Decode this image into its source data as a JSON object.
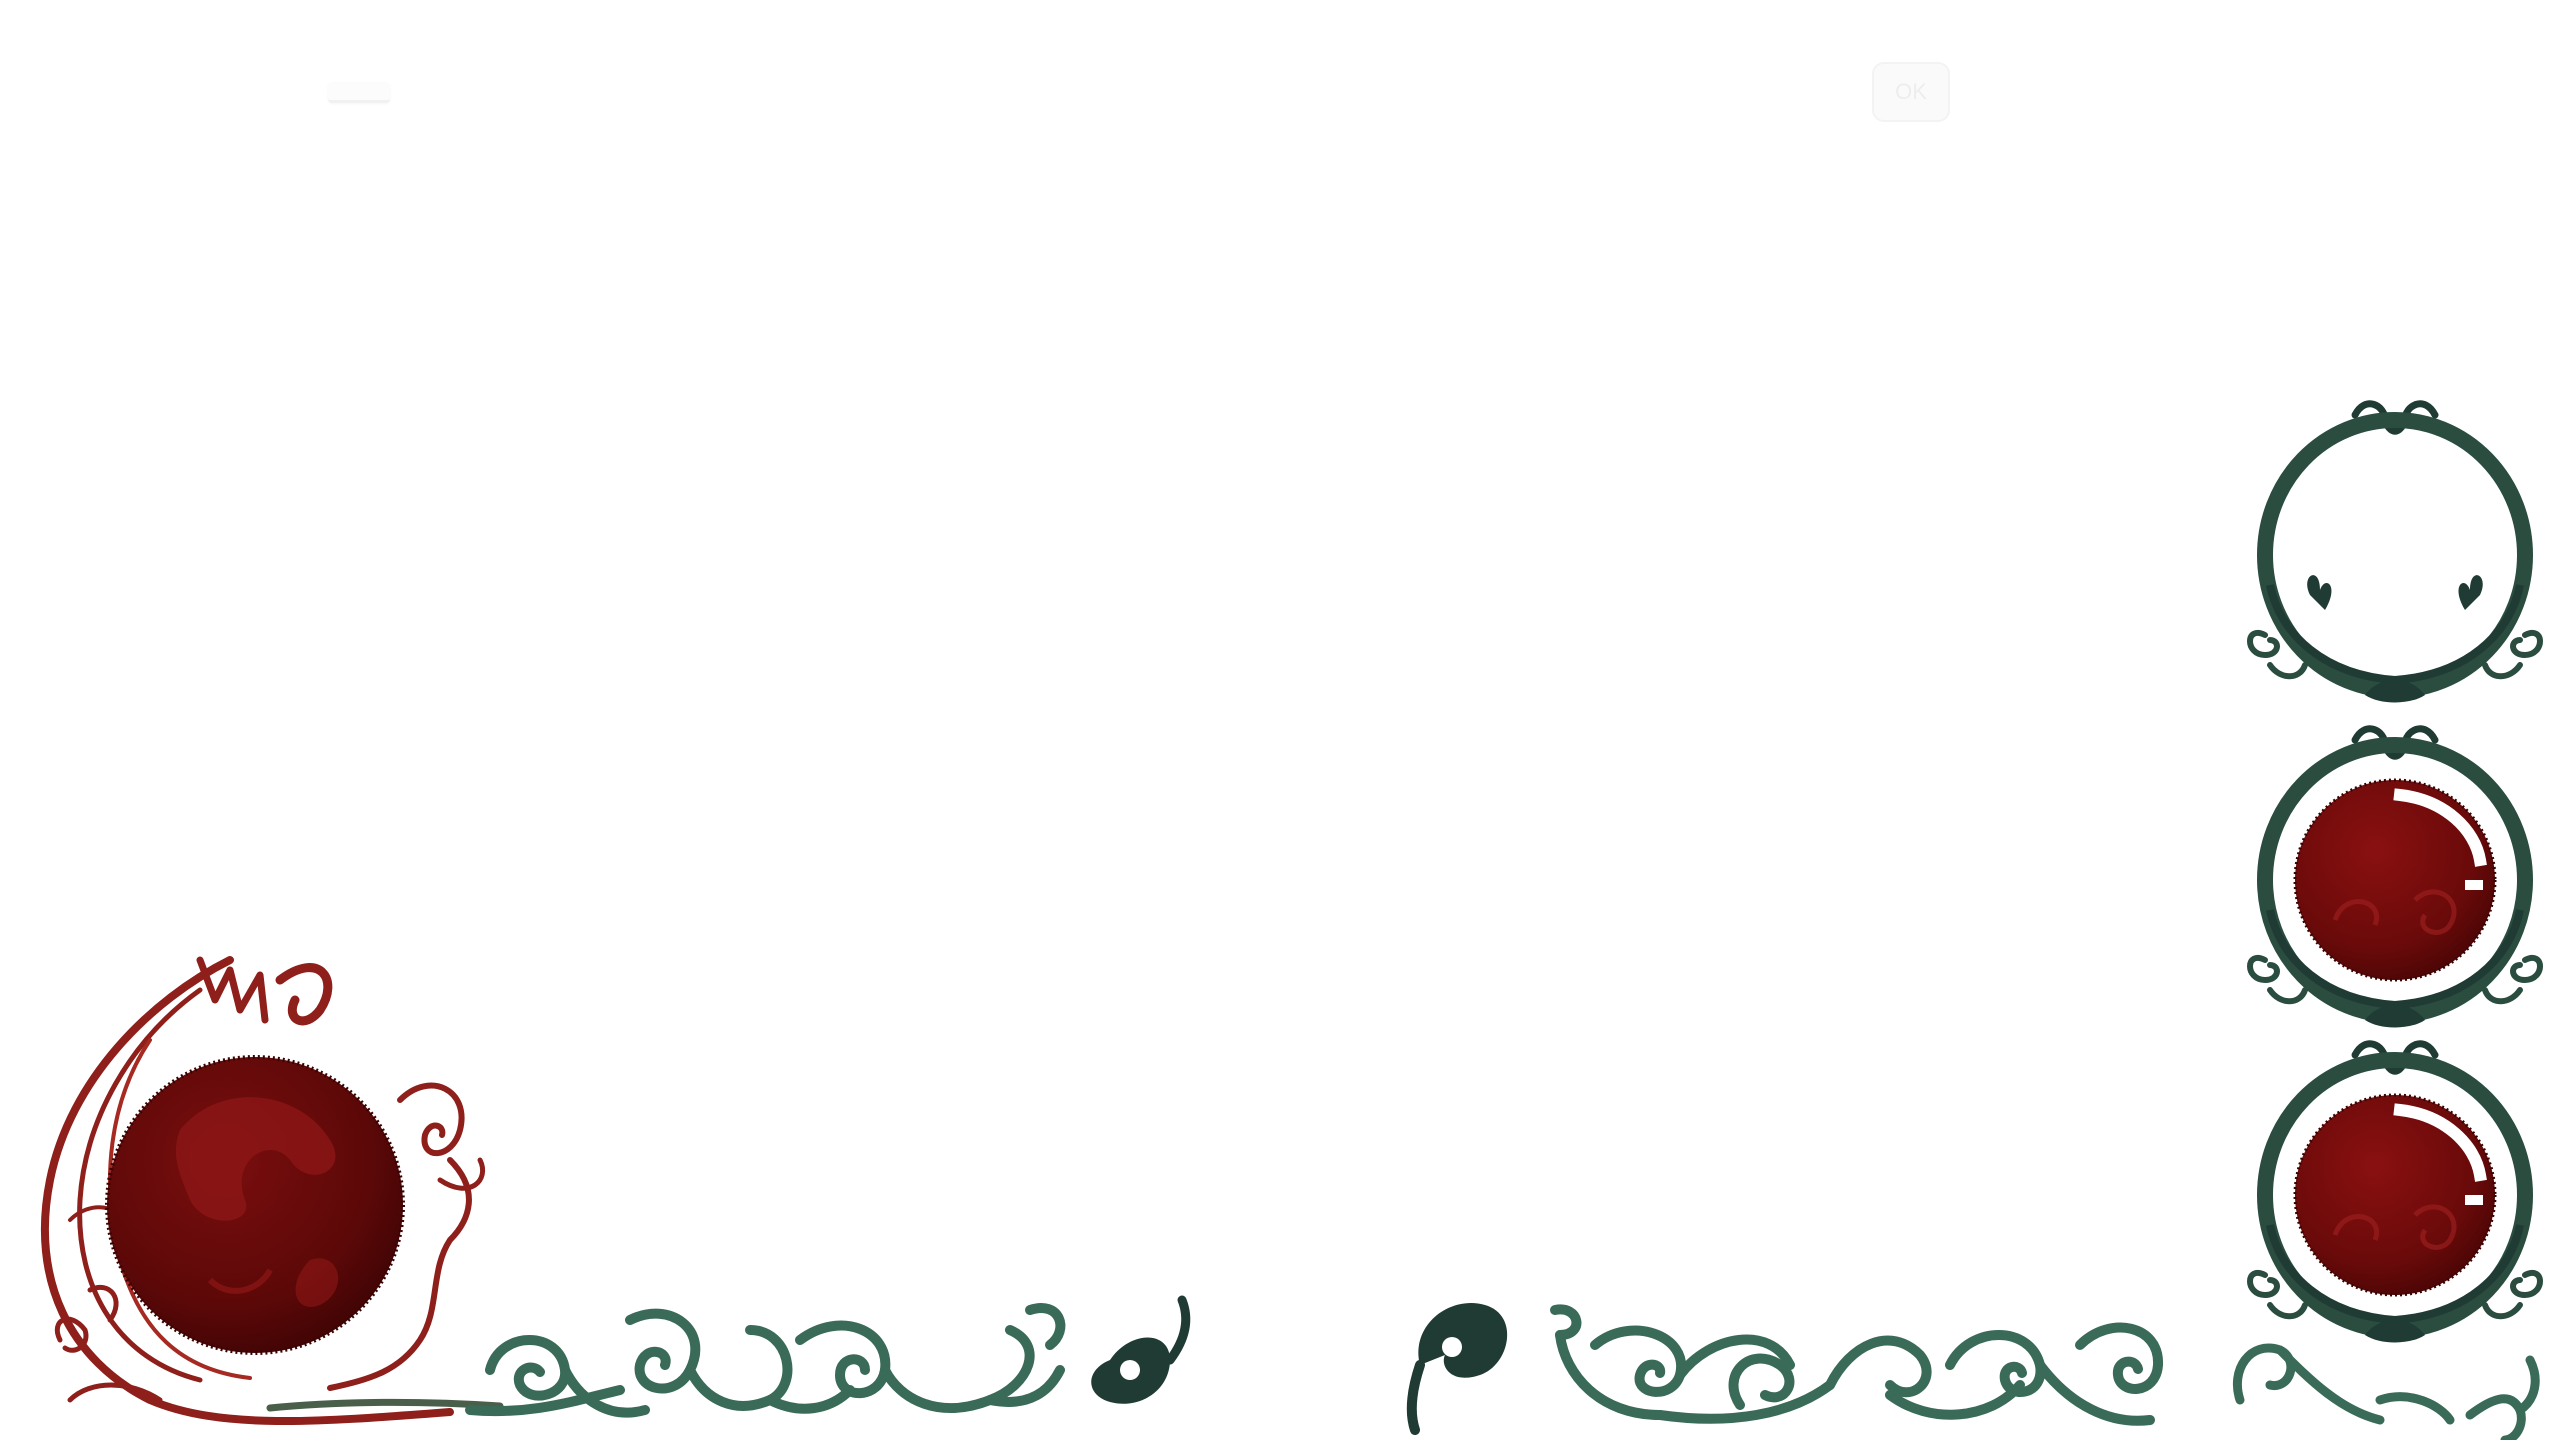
{
  "screen": {
    "top_tab_label": "",
    "top_button_label": "OK"
  },
  "hud": {
    "life_orbs_total": 3,
    "life_orbs_filled": 2,
    "mana_orb_fill": 1.0
  },
  "colors": {
    "background": "#ffffff",
    "vine_green": "#2f5a4a",
    "vine_dark": "#1f3b33",
    "ornament_red": "#8e1f1a",
    "orb_red": "#6b0b0b",
    "orb_dark": "#4a0505",
    "orb_highlight": "#9a1e1e"
  },
  "icons": {
    "mana_orb": "red-orb-icon",
    "life_orb": "red-orb-icon",
    "empty_life_slot": "empty-ring-icon"
  }
}
